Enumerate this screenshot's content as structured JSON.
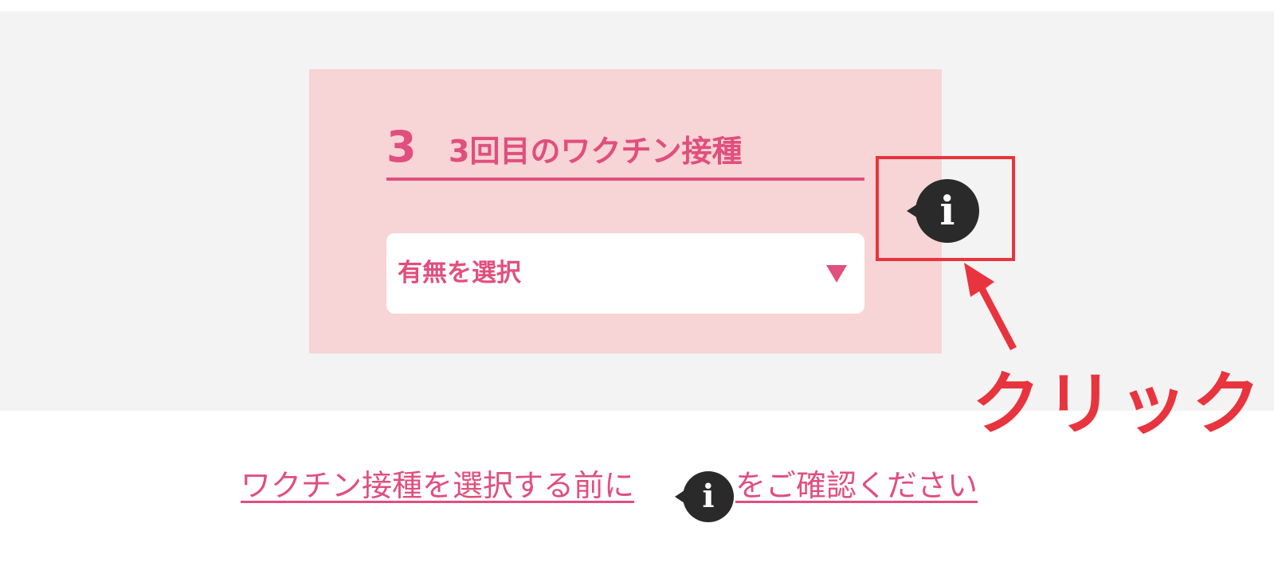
{
  "card": {
    "step_number": "3",
    "title": "3回目のワクチン接種"
  },
  "select": {
    "value": "有無を選択",
    "caret_icon": "triangle-down-icon"
  },
  "info_button": {
    "glyph": "i",
    "icon": "info-speech-bubble-icon"
  },
  "annotation": {
    "label": "クリック",
    "color": "#e8343e"
  },
  "notice": {
    "before": "ワクチン接種を選択する前に",
    "after": "をご確認ください",
    "info_glyph": "i"
  },
  "colors": {
    "accent": "#e04f7e",
    "card_background": "#f7d4d5",
    "page_band": "#f3f3f3",
    "info_icon": "#2a2a2a"
  }
}
